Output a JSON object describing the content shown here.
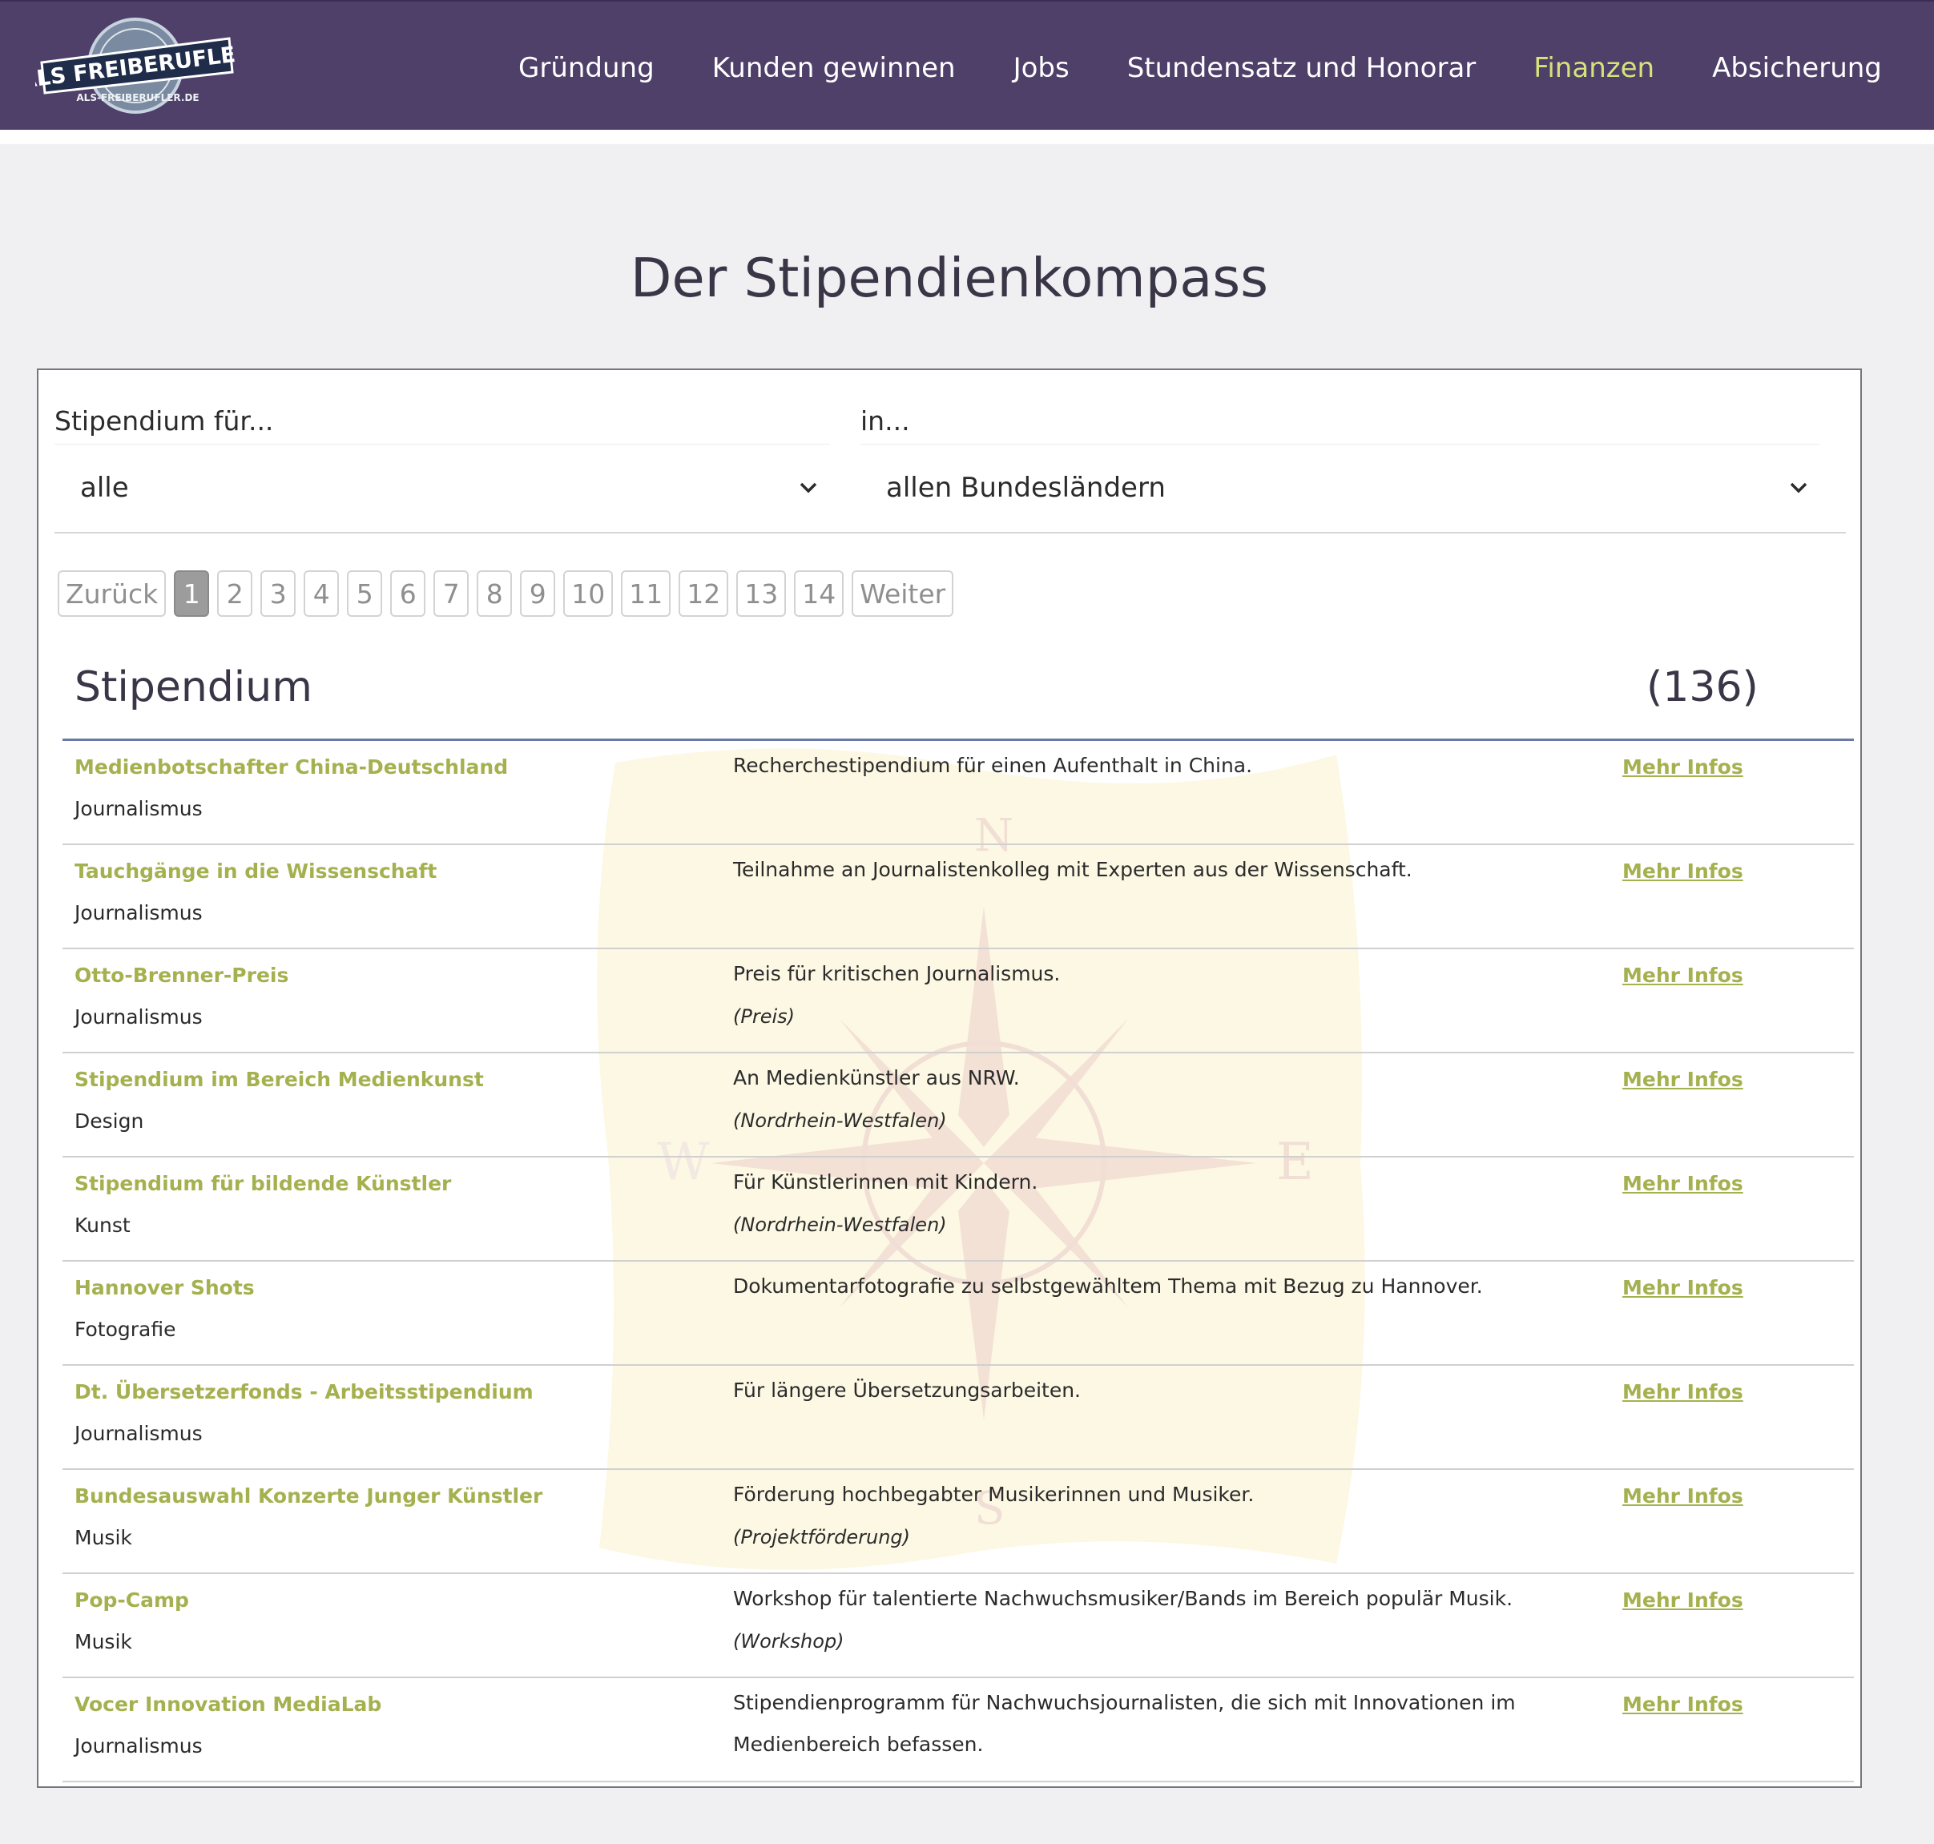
{
  "brand": {
    "logo_text_main": "ALS FREIBERUFLER",
    "logo_text_sub": "ALS-FREIBERUFLER.DE"
  },
  "nav": [
    {
      "label": "Gründung",
      "active": false
    },
    {
      "label": "Kunden gewinnen",
      "active": false
    },
    {
      "label": "Jobs",
      "active": false
    },
    {
      "label": "Stundensatz und Honorar",
      "active": false
    },
    {
      "label": "Finanzen",
      "active": true
    },
    {
      "label": "Absicherung",
      "active": false
    }
  ],
  "page_title": "Der Stipendienkompass",
  "filters": {
    "for_label": "Stipendium für...",
    "for_value": "alle",
    "in_label": "in...",
    "in_value": "allen Bundesländern"
  },
  "pagination": {
    "prev": "Zurück",
    "next": "Weiter",
    "current": "1",
    "pages": [
      "1",
      "2",
      "3",
      "4",
      "5",
      "6",
      "7",
      "8",
      "9",
      "10",
      "11",
      "12",
      "13",
      "14"
    ]
  },
  "table": {
    "heading": "Stipendium",
    "count": "(136)",
    "link_label": "Mehr Infos",
    "rows": [
      {
        "name": "Medienbotschafter China-Deutschland",
        "category": "Journalismus",
        "description": "Recherchestipendium für einen Aufenthalt in China.",
        "note": ""
      },
      {
        "name": "Tauchgänge in die Wissenschaft",
        "category": "Journalismus",
        "description": "Teilnahme an Journalistenkolleg mit Experten aus der Wissenschaft.",
        "note": ""
      },
      {
        "name": "Otto-Brenner-Preis",
        "category": "Journalismus",
        "description": "Preis für kritischen Journalismus.",
        "note": "(Preis)"
      },
      {
        "name": "Stipendium im Bereich Medienkunst",
        "category": "Design",
        "description": "An Medienkünstler aus NRW.",
        "note": "(Nordrhein-Westfalen)"
      },
      {
        "name": "Stipendium für bildende Künstler",
        "category": "Kunst",
        "description": "Für Künstlerinnen mit Kindern.",
        "note": "(Nordrhein-Westfalen)"
      },
      {
        "name": "Hannover Shots",
        "category": "Fotografie",
        "description": "Dokumentarfotografie zu selbstgewähltem Thema mit Bezug zu Hannover.",
        "note": ""
      },
      {
        "name": "Dt. Übersetzerfonds - Arbeitsstipendium",
        "category": "Journalismus",
        "description": "Für längere Übersetzungsarbeiten.",
        "note": ""
      },
      {
        "name": "Bundesauswahl Konzerte Junger Künstler",
        "category": "Musik",
        "description": "Förderung hochbegabter Musikerinnen und Musiker.",
        "note": "(Projektförderung)"
      },
      {
        "name": "Pop-Camp",
        "category": "Musik",
        "description": "Workshop für talentierte Nachwuchsmusiker/Bands im Bereich populär Musik.",
        "note": "(Workshop)"
      },
      {
        "name": "Vocer Innovation MediaLab",
        "category": "Journalismus",
        "description": "Stipendienprogramm für Nachwuchsjournalisten, die sich mit Innovationen im Medienbereich befassen.",
        "note": ""
      }
    ]
  },
  "watermark": {
    "compass_letters": [
      "N",
      "W",
      "E",
      "S"
    ]
  },
  "colors": {
    "header_bg": "#4e4069",
    "nav_active": "#d6e27a",
    "link_green": "#a5b14f",
    "table_rule": "#6878a7",
    "page_bg": "#f0f0f2"
  },
  "icons": {
    "select_chevron": "chevron-down-icon",
    "logo": "badge-logo-icon",
    "watermark": "compass-map-icon"
  }
}
